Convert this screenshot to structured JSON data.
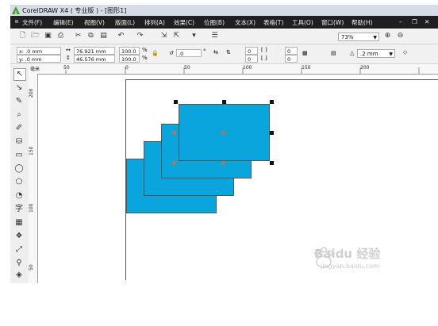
{
  "window": {
    "title": "CorelDRAW X4 ( 专业版 ) - [图形1]",
    "controls": {
      "min": "–",
      "restore": "❐",
      "close": "✕"
    }
  },
  "menubar": {
    "items": [
      "文件(F)",
      "编辑(E)",
      "视图(V)",
      "版面(L)",
      "排列(A)",
      "效果(C)",
      "位图(B)",
      "文本(X)",
      "表格(T)",
      "工具(O)",
      "窗口(W)",
      "帮助(H)"
    ]
  },
  "toolbar": {
    "zoom": "73%"
  },
  "property_bar": {
    "x": "x: .0 mm",
    "y": "y: .0 mm",
    "width": "76.921 mm",
    "height": "46.576 mm",
    "scale_w": "100.0",
    "scale_h": "100.0",
    "percent": "%",
    "rotation": ".0",
    "degree": "°",
    "corner_tl": "0",
    "corner_bl": "0",
    "corner_tr": "0",
    "corner_br": "0",
    "outline": ".2 mm"
  },
  "rulers": {
    "unit": "毫米",
    "h_labels": [
      "50",
      "0",
      "50",
      "100",
      "150",
      "200"
    ],
    "v_labels": [
      "200",
      "150",
      "100",
      "50"
    ]
  },
  "watermark": {
    "brand": "Baidu 经验",
    "url": "jingyan.baidu.com"
  },
  "colors": {
    "fill": "#0aa5dd",
    "menubar": "#1f1f1f"
  }
}
